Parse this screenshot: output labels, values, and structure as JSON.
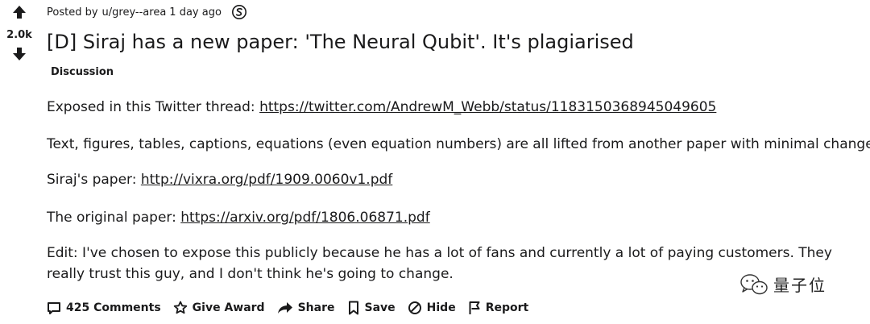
{
  "vote": {
    "score": "2.0k"
  },
  "post": {
    "meta": {
      "posted_by": "Posted by",
      "author": "u/grey--area",
      "age": "1 day ago"
    },
    "title": "[D] Siraj has a new paper: 'The Neural Qubit'. It's plagiarised",
    "flair": "Discussion",
    "body": {
      "p1_text": "Exposed in this Twitter thread: ",
      "p1_link": "https://twitter.com/AndrewM_Webb/status/1183150368945049605",
      "p2_text": "Text, figures, tables, captions, equations (even equation numbers) are all lifted from another paper with minimal changes.",
      "p3_text": "Siraj's paper: ",
      "p3_link": "http://vixra.org/pdf/1909.0060v1.pdf",
      "p4_text": "The original paper: ",
      "p4_link": "https://arxiv.org/pdf/1806.06871.pdf",
      "p5_text": "Edit: I've chosen to expose this publicly because he has a lot of fans and currently a lot of paying customers. They really trust this guy, and I don't think he's going to change."
    }
  },
  "actions": {
    "comments": "425 Comments",
    "give_award": "Give Award",
    "share": "Share",
    "save": "Save",
    "hide": "Hide",
    "report": "Report"
  },
  "icons": {
    "upvote": "upvote-arrow-icon",
    "downvote": "downvote-arrow-icon",
    "award": "award-coin-icon",
    "comments": "comment-bubble-icon",
    "give_award": "award-star-icon",
    "share": "share-arrow-icon",
    "save": "bookmark-icon",
    "hide": "hide-circle-slash-icon",
    "report": "flag-icon",
    "watermark": "wechat-logo-icon"
  },
  "watermark": {
    "text": "量子位"
  }
}
